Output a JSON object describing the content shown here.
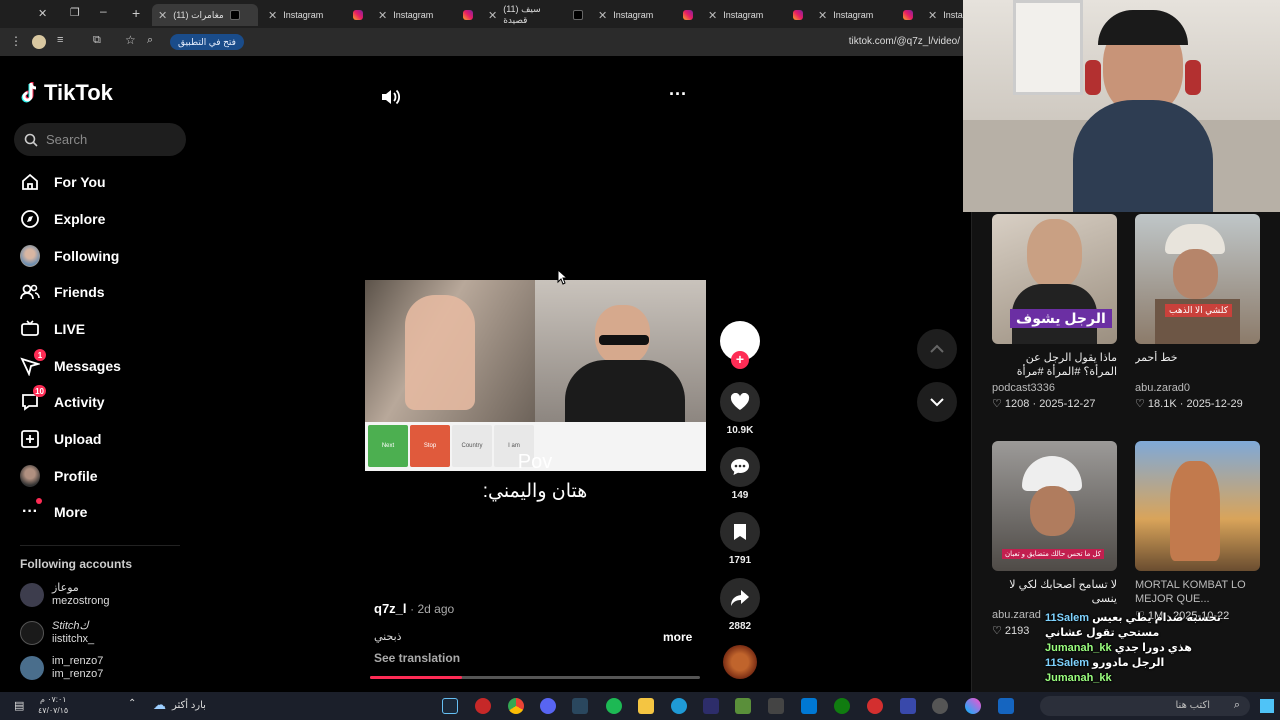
{
  "browser": {
    "tabs": [
      {
        "title": "(11) مغامرات",
        "icon": "tiktok-icon",
        "active": true
      },
      {
        "title": "Instagram",
        "icon": "instagram-icon"
      },
      {
        "title": "Instagram",
        "icon": "instagram-icon"
      },
      {
        "title": "(11) سيف قصيدة",
        "icon": "tiktok-icon"
      },
      {
        "title": "Instagram",
        "icon": "instagram-icon"
      },
      {
        "title": "Instagram",
        "icon": "instagram-icon"
      },
      {
        "title": "Instagram",
        "icon": "instagram-icon"
      },
      {
        "title": "Insta",
        "icon": "instagram-icon"
      }
    ],
    "url": "tiktok.com/@q7z_l/video/",
    "open_app_label": "فتح في التطبيق"
  },
  "sidebar": {
    "logo": "TikTok",
    "search_placeholder": "Search",
    "nav": [
      {
        "label": "For You",
        "icon": "home-icon"
      },
      {
        "label": "Explore",
        "icon": "compass-icon"
      },
      {
        "label": "Following",
        "icon": "avatar-icon"
      },
      {
        "label": "Friends",
        "icon": "friends-icon"
      },
      {
        "label": "LIVE",
        "icon": "live-icon"
      },
      {
        "label": "Messages",
        "icon": "messages-icon",
        "badge": "1"
      },
      {
        "label": "Activity",
        "icon": "activity-icon",
        "badge": "10"
      },
      {
        "label": "Upload",
        "icon": "upload-icon"
      },
      {
        "label": "Profile",
        "icon": "profile-icon"
      },
      {
        "label": "More",
        "icon": "more-icon"
      }
    ],
    "following_title": "Following accounts",
    "accounts": [
      {
        "name": "موعاز",
        "handle": "mezostrong"
      },
      {
        "name": "Stitchك",
        "handle": "iistitchx_"
      },
      {
        "name": "im_renzo7",
        "handle": "im_renzo7"
      }
    ]
  },
  "video": {
    "caption_top": "Pov",
    "caption_bottom": "هتان واليمني:",
    "author": "q7z_l",
    "posted": "· 2d ago",
    "description": "ذبحني",
    "more_label": "more",
    "translate_label": "See translation",
    "progress": 0.28,
    "overlay_buttons": [
      "Next",
      "Stop",
      "Country",
      "I am"
    ]
  },
  "actions": {
    "likes": "10.9K",
    "comments": "149",
    "saves": "1791",
    "shares": "2882"
  },
  "recommended": [
    {
      "title": "ماذا يقول الرجل عن المرأة؟ #المرأة #مرأة #بنت...",
      "author": "podcast3336",
      "likes": "1208",
      "date": "2025-12-27",
      "thumb_text": "الرجل يشوف"
    },
    {
      "title": "خط أحمر",
      "author": "abu.zarad0",
      "likes": "18.1K",
      "date": "2025-12-29",
      "thumb_text": "كلشي الا الذهب"
    },
    {
      "title": "لا تسامح أصحابك لكي لا ينسى",
      "author": "abu.zarad",
      "likes": "2193",
      "date": "",
      "thumb_text": "كل ما تحس حالك متضايق و تعبان"
    },
    {
      "title": "MORTAL KOMBAT LO MEJOR QUE...",
      "author": "",
      "likes": "1M",
      "date": "2025-10-22",
      "thumb_text": ""
    }
  ],
  "chat": [
    {
      "user": "11Salem",
      "text": "تحسبه صدام يطي بعيس"
    },
    {
      "user": "",
      "text": "مستحي تقول عشاني"
    },
    {
      "user": "Jumanah_kk",
      "text": "هذي دورا جدي"
    },
    {
      "user": "11Salem",
      "text": "الرجل مادورو"
    },
    {
      "user": "Jumanah_kk",
      "text": ""
    }
  ],
  "taskbar": {
    "weather": "بارد أكثر",
    "time": "٠٧:٠١ م",
    "date": "٤٧/٠٧/١٥",
    "search_hint": "اكتب هنا"
  },
  "colors": {
    "accent": "#fe2c55",
    "panel": "#121212"
  }
}
